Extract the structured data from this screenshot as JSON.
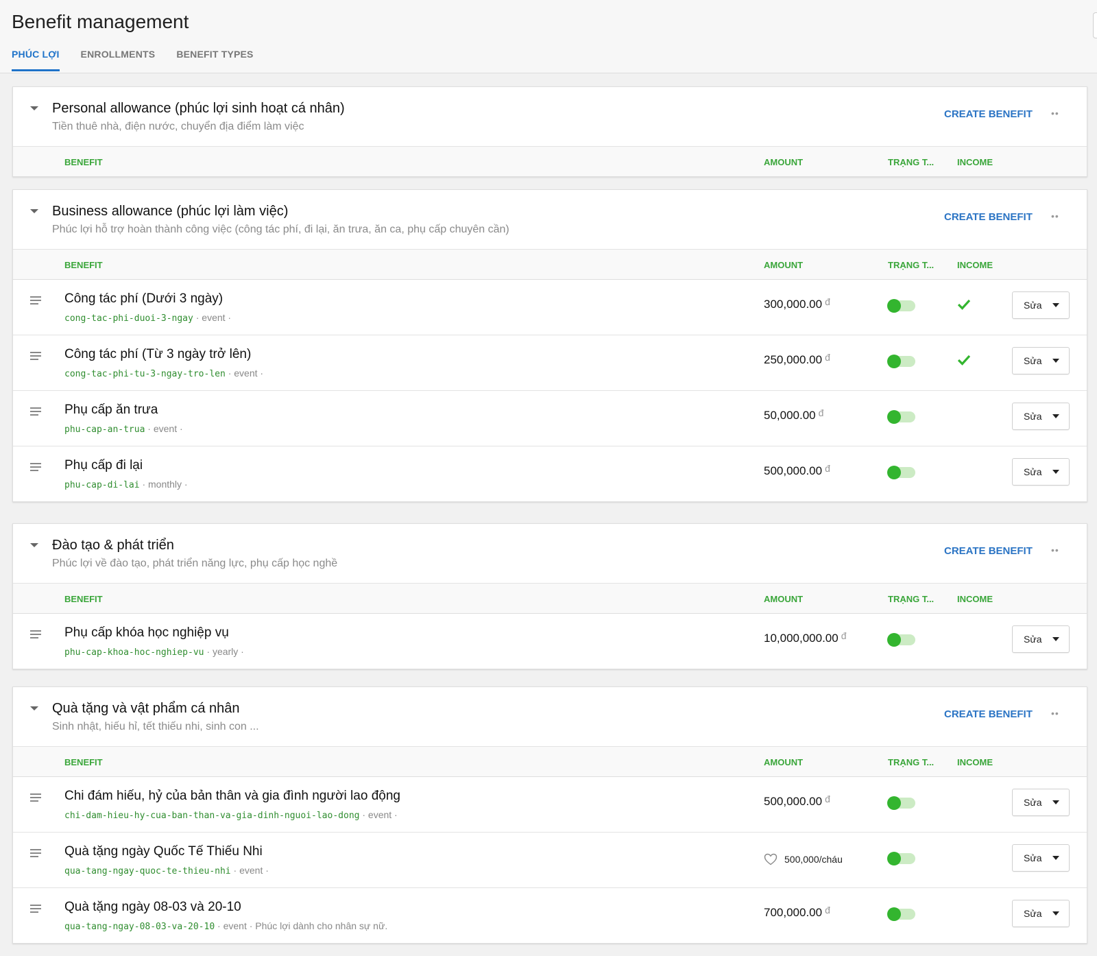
{
  "page": {
    "title": "Benefit management"
  },
  "tabs": [
    {
      "label": "PHÚC LỢI",
      "active": true
    },
    {
      "label": "ENROLLMENTS",
      "active": false
    },
    {
      "label": "BENEFIT TYPES",
      "active": false
    }
  ],
  "columns": {
    "benefit": "BENEFIT",
    "amount": "AMOUNT",
    "status": "TRẠNG T...",
    "income": "INCOME"
  },
  "labels": {
    "create_benefit": "CREATE BENEFIT",
    "more": "••",
    "edit": "Sửa",
    "currency": "đ"
  },
  "colors": {
    "accent_blue": "#1f73c9",
    "green": "#33b52f",
    "header_green": "#3aa63a",
    "slug_green": "#2f8d2f"
  },
  "groups": [
    {
      "title": "Personal allowance (phúc lợi sinh hoạt cá nhân)",
      "description": "Tiền thuê nhà, điện nước, chuyển địa điểm làm việc",
      "benefits": []
    },
    {
      "title": "Business allowance (phúc lợi làm việc)",
      "description": "Phúc lợi hỗ trợ hoàn thành công việc (công tác phí, đi lại, ăn trưa, ăn ca, phụ cấp chuyên cần)",
      "benefits": [
        {
          "name": "Công tác phí (Dưới 3 ngày)",
          "slug": "cong-tac-phi-duoi-3-ngay",
          "meta": " · event ·",
          "amount": "300,000.00",
          "enabled": true,
          "income": true
        },
        {
          "name": "Công tác phí (Từ 3 ngày trở lên)",
          "slug": "cong-tac-phi-tu-3-ngay-tro-len",
          "meta": " · event ·",
          "amount": "250,000.00",
          "enabled": true,
          "income": true
        },
        {
          "name": "Phụ cấp ăn trưa",
          "slug": "phu-cap-an-trua",
          "meta": " · event ·",
          "amount": "50,000.00",
          "enabled": true,
          "income": false
        },
        {
          "name": "Phụ cấp đi lại",
          "slug": "phu-cap-di-lai",
          "meta": " · monthly ·",
          "amount": "500,000.00",
          "enabled": true,
          "income": false
        }
      ]
    },
    {
      "title": "Đào tạo & phát triển",
      "description": "Phúc lợi về đào tạo, phát triển năng lực, phụ cấp học nghề",
      "benefits": [
        {
          "name": "Phụ cấp khóa học nghiệp vụ",
          "slug": "phu-cap-khoa-hoc-nghiep-vu",
          "meta": " · yearly ·",
          "amount": "10,000,000.00",
          "enabled": true,
          "income": false
        }
      ]
    },
    {
      "title": "Quà tặng và vật phẩm cá nhân",
      "description": "Sinh nhật, hiếu hỉ, tết thiếu nhi, sinh con ...",
      "benefits": [
        {
          "name": "Chi đám hiếu, hỷ của bản thân và gia đình người lao động",
          "slug": "chi-dam-hieu-hy-cua-ban-than-va-gia-dinh-nguoi-lao-dong",
          "meta": " · event ·",
          "amount": "500,000.00",
          "enabled": true,
          "income": false
        },
        {
          "name": "Quà tặng ngày Quốc Tế Thiếu Nhi",
          "slug": "qua-tang-ngay-quoc-te-thieu-nhi",
          "meta": " · event ·",
          "amount_per": "500,000/cháu",
          "enabled": true,
          "income": false
        },
        {
          "name": "Quà tặng ngày 08-03 và 20-10",
          "slug": "qua-tang-ngay-08-03-va-20-10",
          "meta": " · event · Phúc lợi dành cho nhân sự nữ.",
          "amount": "700,000.00",
          "enabled": true,
          "income": false
        }
      ]
    }
  ]
}
